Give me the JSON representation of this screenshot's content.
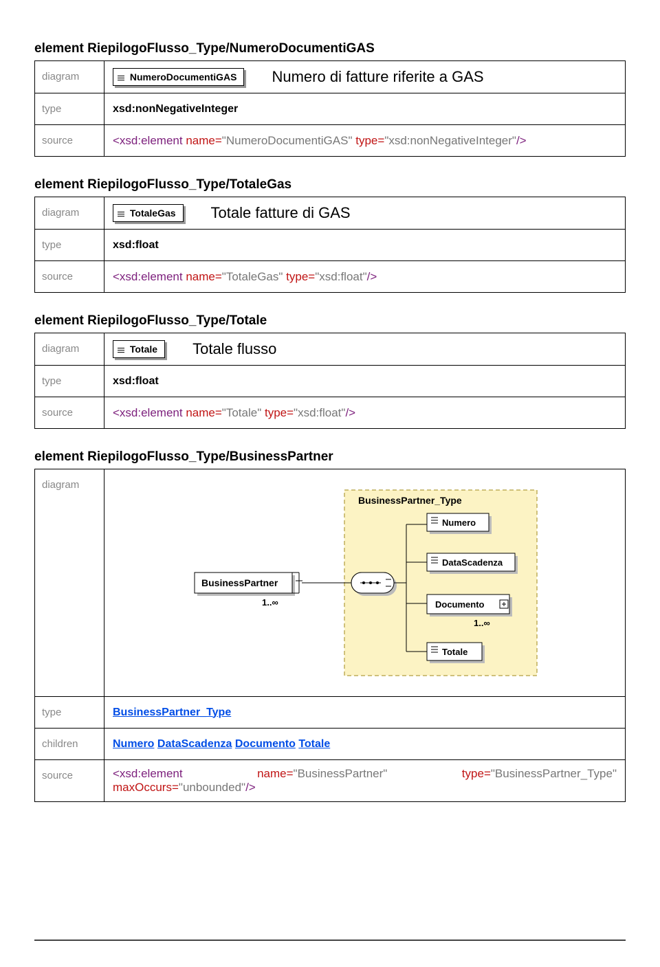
{
  "sections": [
    {
      "heading_prefix": "element ",
      "heading_name": "RiepilogoFlusso_Type/NumeroDocumentiGAS",
      "rows": {
        "diagram_label": "diagram",
        "box_label": "NumeroDocumentiGAS",
        "description": "Numero di fatture riferite a GAS",
        "type_label": "type",
        "type_value": "xsd:nonNegativeInteger",
        "source_label": "source",
        "source_el": "<xsd:element",
        "source_name_attr": "name",
        "source_name_val": "\"NumeroDocumentiGAS\"",
        "source_type_attr": "type",
        "source_type_val": "\"xsd:nonNegativeInteger\"",
        "source_close": "/>"
      }
    },
    {
      "heading_prefix": "element ",
      "heading_name": "RiepilogoFlusso_Type/TotaleGas",
      "rows": {
        "diagram_label": "diagram",
        "box_label": "TotaleGas",
        "description": "Totale fatture di GAS",
        "type_label": "type",
        "type_value": "xsd:float",
        "source_label": "source",
        "source_el": "<xsd:element",
        "source_name_attr": "name",
        "source_name_val": "\"TotaleGas\"",
        "source_type_attr": "type",
        "source_type_val": "\"xsd:float\"",
        "source_close": "/>"
      }
    },
    {
      "heading_prefix": "element ",
      "heading_name": "RiepilogoFlusso_Type/Totale",
      "rows": {
        "diagram_label": "diagram",
        "box_label": "Totale",
        "description": "Totale flusso",
        "type_label": "type",
        "type_value": "xsd:float",
        "source_label": "source",
        "source_el": "<xsd:element",
        "source_name_attr": "name",
        "source_name_val": "\"Totale\"",
        "source_type_attr": "type",
        "source_type_val": "\"xsd:float\"",
        "source_close": "/>"
      }
    }
  ],
  "bp": {
    "heading_prefix": "element ",
    "heading_name": "RiepilogoFlusso_Type/BusinessPartner",
    "diagram_label": "diagram",
    "diagram_title": "BusinessPartner_Type",
    "root": "BusinessPartner",
    "root_card": "1..∞",
    "children": [
      "Numero",
      "DataScadenza",
      "Documento",
      "Totale"
    ],
    "doc_card": "1..∞",
    "type_label": "type",
    "type_link": "BusinessPartner_Type",
    "children_label": "children",
    "children_links": [
      "Numero",
      "DataScadenza",
      "Documento",
      "Totale"
    ],
    "source_label": "source",
    "src_el": "<xsd:element",
    "src_name_attr": "name",
    "src_name_val": "\"BusinessPartner\"",
    "src_type_attr": "type",
    "src_type_val": "\"BusinessPartner_Type\"",
    "src_max_attr": "maxOccurs",
    "src_max_val": "\"unbounded\"",
    "src_close": "/>"
  }
}
